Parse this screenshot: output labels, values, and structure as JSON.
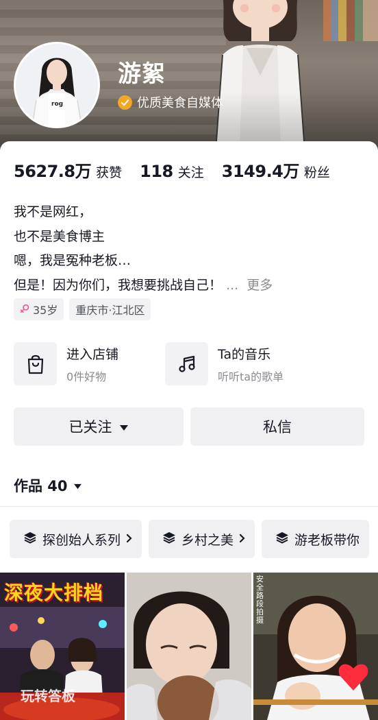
{
  "profile": {
    "nickname": "游絮",
    "verification": "优质美食自媒体",
    "verification_icon": "verified-check-icon"
  },
  "stats": [
    {
      "value": "5627.8万",
      "label": "获赞"
    },
    {
      "value": "118",
      "label": "关注"
    },
    {
      "value": "3149.4万",
      "label": "粉丝"
    }
  ],
  "bio": {
    "lines": [
      "我不是网红，",
      "也不是美食博主",
      "嗯，我是冤种老板…",
      "但是！因为你们，我想要挑战自己！"
    ],
    "ellipsis": "...",
    "more": "更多"
  },
  "tags": [
    {
      "icon": "female-icon",
      "text": "35岁"
    },
    {
      "text": "重庆市·江北区"
    }
  ],
  "entries": [
    {
      "icon": "shopping-bag-icon",
      "title": "进入店铺",
      "subtitle": "0件好物"
    },
    {
      "icon": "music-note-icon",
      "title": "Ta的音乐",
      "subtitle": "听听ta的歌单"
    }
  ],
  "actions": {
    "follow": "已关注",
    "message": "私信"
  },
  "works": {
    "label": "作品 40"
  },
  "collections": [
    {
      "icon": "layers-icon",
      "label": "探创始人系列"
    },
    {
      "icon": "layers-icon",
      "label": "乡村之美"
    },
    {
      "icon": "layers-icon",
      "label": "游老板带你"
    }
  ],
  "videos": [
    {
      "caption": "深夜大排档",
      "watermark": "玩转答板"
    },
    {
      "caption": ""
    },
    {
      "caption": "安全路段拍摄"
    }
  ],
  "colors": {
    "verify_badge": "#f5a623",
    "caption_yellow": "#f9d51c",
    "muted": "#8a8b91"
  }
}
